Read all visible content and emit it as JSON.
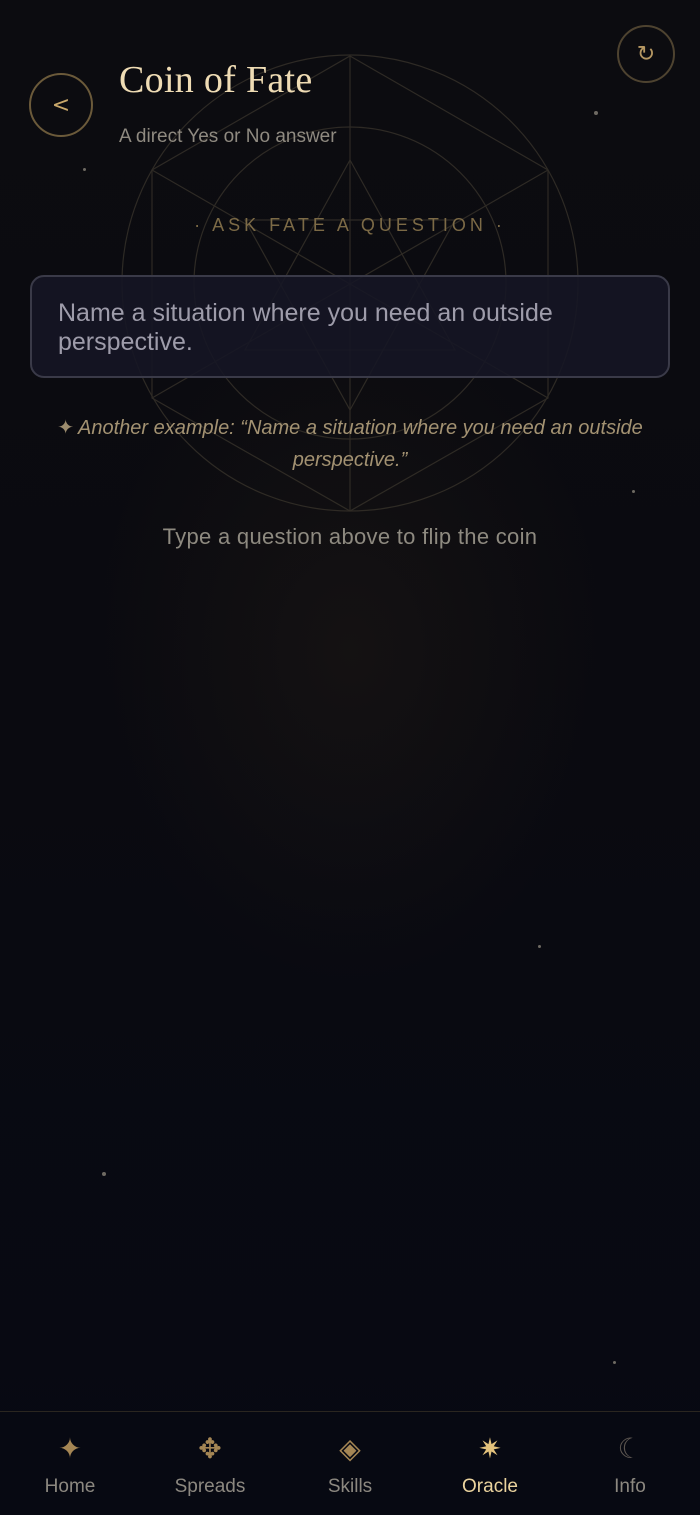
{
  "header": {
    "title": "Coin of Fate",
    "subtitle": "A direct Yes or No answer",
    "back_icon": "chevron-left-icon",
    "back_glyph": "<",
    "reset_icon": "refresh-icon",
    "reset_glyph": "↻"
  },
  "prompt": {
    "section_label": "· ASK FATE A QUESTION ·",
    "input_value": "",
    "input_placeholder": "Name a situation where you need an outside perspective.",
    "example_glyph": "✦",
    "example_text": "Another example: “Name a situation where you need an outside perspective.”",
    "hint": "Type a question above to flip the coin"
  },
  "tabbar": {
    "items": [
      {
        "label": "Home",
        "icon": "four-point-star-icon",
        "glyph": "✦"
      },
      {
        "label": "Spreads",
        "icon": "flower-cross-icon",
        "glyph": "✥"
      },
      {
        "label": "Skills",
        "icon": "diamond-icon",
        "glyph": "◈"
      },
      {
        "label": "Oracle",
        "icon": "sunburst-icon",
        "glyph": "✷"
      },
      {
        "label": "Info",
        "icon": "crescent-moon-icon",
        "glyph": "☾"
      }
    ],
    "active": "Oracle"
  },
  "colors": {
    "background": "#080a14",
    "accent_gold": "#c9a86a",
    "title": "#efdcb4",
    "active_tab": "#ead39e"
  }
}
